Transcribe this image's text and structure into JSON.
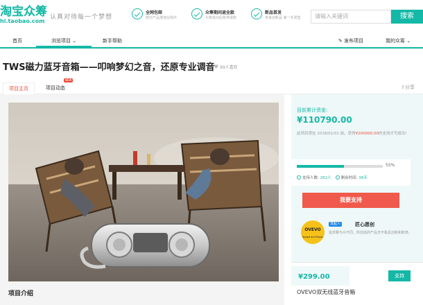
{
  "header": {
    "logo_main": "淘宝众筹",
    "logo_sub": "hi.taobao.com",
    "slogan": "认真对待每一个梦想",
    "features": [
      {
        "title": "全网包邮",
        "subtitle": "部分产品港澳台除外"
      },
      {
        "title": "众筹期间退全款",
        "subtitle": "众筹成功后暂停退款"
      },
      {
        "title": "新品首发",
        "subtitle": "未来创新品 第一手发售"
      }
    ],
    "search_placeholder": "请输入关键词",
    "search_button": "搜索"
  },
  "nav": {
    "items": [
      "首页",
      "浏览项目",
      "新手帮助"
    ],
    "publish": "发布项目",
    "my_account": "我的众筹"
  },
  "project": {
    "title": "TWS磁力蓝牙音箱——叩响梦幻之音，还原专业调音",
    "likes": "99人喜欢",
    "tabs": [
      "项目主页",
      "项目动态"
    ],
    "new_badge": "NEW",
    "share": "分享",
    "intro_heading": "项目介绍"
  },
  "funding": {
    "label": "目前累计资金:",
    "amount": "¥110790.00",
    "desc_prefix": "此项目须在 2018/01/01 前，获得",
    "goal": "¥200000.00",
    "desc_suffix": "的支持才可成功!",
    "progress_percent": 55,
    "progress_label": "55%",
    "supporters_label": "支持人数:",
    "supporters_count": "262人",
    "remaining_label": "剩余时间:",
    "remaining_value": "38天",
    "support_button": "我要支持"
  },
  "brand": {
    "logo_text": "OVEVO",
    "logo_sub": "Speed and Music",
    "badge": "发起人",
    "name": "匠心愿创",
    "desc": "追求着与众不同，所创造的产品无不极具创新和新奇。"
  },
  "reward": {
    "price": "¥299.00",
    "button": "支持",
    "title": "OVEVO双无线蓝牙音箱"
  },
  "colors": {
    "accent": "#14b8a6",
    "alert": "#ef5a4c"
  }
}
